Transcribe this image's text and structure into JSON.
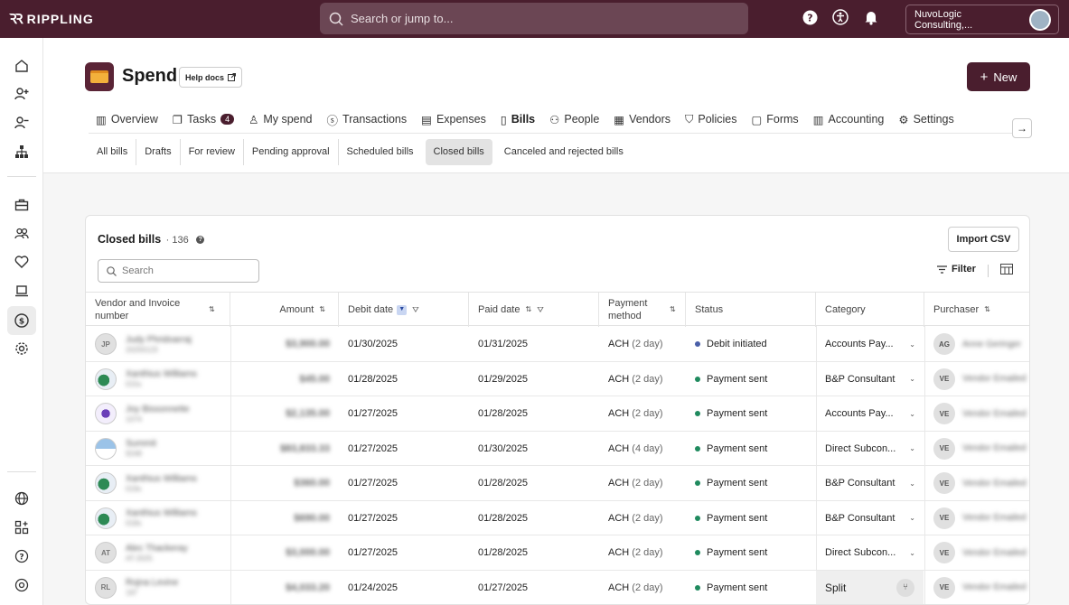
{
  "app": {
    "logo_text": "RIPPLING"
  },
  "topbar": {
    "search_placeholder": "Search or jump to...",
    "company_name": "NuvoLogic Consulting,..."
  },
  "page": {
    "title": "Spend",
    "help_docs_label": "Help docs",
    "new_button_label": "New"
  },
  "tabs": [
    {
      "label": "Overview",
      "icon": "chart-icon"
    },
    {
      "label": "Tasks",
      "icon": "tasks-icon",
      "badge": "4"
    },
    {
      "label": "My spend",
      "icon": "person-icon"
    },
    {
      "label": "Transactions",
      "icon": "dollar-icon"
    },
    {
      "label": "Expenses",
      "icon": "receipt-icon"
    },
    {
      "label": "Bills",
      "icon": "bill-icon",
      "active": true
    },
    {
      "label": "People",
      "icon": "people-icon"
    },
    {
      "label": "Vendors",
      "icon": "building-icon"
    },
    {
      "label": "Policies",
      "icon": "shield-icon"
    },
    {
      "label": "Forms",
      "icon": "form-icon"
    },
    {
      "label": "Accounting",
      "icon": "accounting-icon"
    },
    {
      "label": "Settings",
      "icon": "gear-icon"
    }
  ],
  "subtabs": [
    {
      "label": "All bills"
    },
    {
      "label": "Drafts"
    },
    {
      "label": "For review"
    },
    {
      "label": "Pending approval"
    },
    {
      "label": "Scheduled bills"
    },
    {
      "label": "Closed bills",
      "active": true
    },
    {
      "label": "Canceled and rejected bills"
    }
  ],
  "panel": {
    "title": "Closed bills",
    "count": "· 136",
    "import_label": "Import CSV",
    "search_placeholder": "Search",
    "filter_label": "Filter"
  },
  "table": {
    "headers": {
      "vendor": "Vendor and Invoice number",
      "amount": "Amount",
      "debit_date": "Debit date",
      "paid_date": "Paid date",
      "payment_method": "Payment method",
      "status": "Status",
      "category": "Category",
      "purchaser": "Purchaser"
    },
    "rows": [
      {
        "vendor_initials": "JP",
        "vendor_logo": "initials",
        "vendor_name": "Judy Phridoarraj",
        "invoice": "20250123",
        "amount": "$3,900.00",
        "debit_date": "01/30/2025",
        "paid_date": "01/31/2025",
        "method": "ACH",
        "method_detail": "(2 day)",
        "status": "Debit initiated",
        "status_color": "#4a5fa8",
        "category": "Accounts Pay...",
        "purchaser_initials": "AG",
        "purchaser_name": "Anne Geringer"
      },
      {
        "vendor_initials": "",
        "vendor_logo": "logo-a",
        "vendor_name": "Xanthius Williams",
        "invoice": "015s",
        "amount": "$45.00",
        "debit_date": "01/28/2025",
        "paid_date": "01/29/2025",
        "method": "ACH",
        "method_detail": "(2 day)",
        "status": "Payment sent",
        "status_color": "#1f8a5e",
        "category": "B&P Consultant",
        "purchaser_initials": "VE",
        "purchaser_name": "Vendor Emailed"
      },
      {
        "vendor_initials": "",
        "vendor_logo": "logo-b",
        "vendor_name": "Joy Bissonnette",
        "invoice": "1074",
        "amount": "$2,135.00",
        "debit_date": "01/27/2025",
        "paid_date": "01/28/2025",
        "method": "ACH",
        "method_detail": "(2 day)",
        "status": "Payment sent",
        "status_color": "#1f8a5e",
        "category": "Accounts Pay...",
        "purchaser_initials": "VE",
        "purchaser_name": "Vendor Emailed"
      },
      {
        "vendor_initials": "",
        "vendor_logo": "logo-c",
        "vendor_name": "Summit",
        "invoice": "9248",
        "amount": "$83,833.33",
        "debit_date": "01/27/2025",
        "paid_date": "01/30/2025",
        "method": "ACH",
        "method_detail": "(4 day)",
        "status": "Payment sent",
        "status_color": "#1f8a5e",
        "category": "Direct Subcon...",
        "purchaser_initials": "VE",
        "purchaser_name": "Vendor Emailed"
      },
      {
        "vendor_initials": "",
        "vendor_logo": "logo-a",
        "vendor_name": "Xanthius Williams",
        "invoice": "019s",
        "amount": "$360.00",
        "debit_date": "01/27/2025",
        "paid_date": "01/28/2025",
        "method": "ACH",
        "method_detail": "(2 day)",
        "status": "Payment sent",
        "status_color": "#1f8a5e",
        "category": "B&P Consultant",
        "purchaser_initials": "VE",
        "purchaser_name": "Vendor Emailed"
      },
      {
        "vendor_initials": "",
        "vendor_logo": "logo-a",
        "vendor_name": "Xanthius Williams",
        "invoice": "018s",
        "amount": "$690.00",
        "debit_date": "01/27/2025",
        "paid_date": "01/28/2025",
        "method": "ACH",
        "method_detail": "(2 day)",
        "status": "Payment sent",
        "status_color": "#1f8a5e",
        "category": "B&P Consultant",
        "purchaser_initials": "VE",
        "purchaser_name": "Vendor Emailed"
      },
      {
        "vendor_initials": "AT",
        "vendor_logo": "initials",
        "vendor_name": "Alec Thackeray",
        "invoice": "AT-2025",
        "amount": "$3,000.00",
        "debit_date": "01/27/2025",
        "paid_date": "01/28/2025",
        "method": "ACH",
        "method_detail": "(2 day)",
        "status": "Payment sent",
        "status_color": "#1f8a5e",
        "category": "Direct Subcon...",
        "purchaser_initials": "VE",
        "purchaser_name": "Vendor Emailed"
      },
      {
        "vendor_initials": "RL",
        "vendor_logo": "initials",
        "vendor_name": "Rojna Levine",
        "invoice": "197",
        "amount": "$4,033.20",
        "debit_date": "01/24/2025",
        "paid_date": "01/27/2025",
        "method": "ACH",
        "method_detail": "(2 day)",
        "status": "Payment sent",
        "status_color": "#1f8a5e",
        "category": "Split",
        "category_split": true,
        "purchaser_initials": "VE",
        "purchaser_name": "Vendor Emailed"
      }
    ]
  }
}
